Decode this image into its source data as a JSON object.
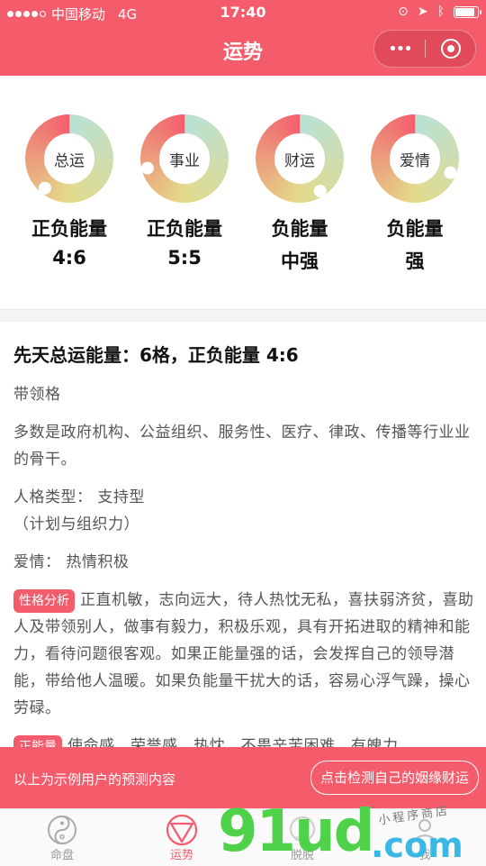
{
  "status_bar": {
    "carrier": "中国移动",
    "network": "4G",
    "time": "17:40"
  },
  "nav": {
    "title": "运势",
    "more_glyph": "•••"
  },
  "colors": {
    "brand": "#f45c6c",
    "gauge_red": "#f45c6c",
    "gauge_yellow": "#e3d98a",
    "gauge_teal": "#b8e2d4"
  },
  "gauges": [
    {
      "label": "总运",
      "line1": "正负能量",
      "line2": "4:6",
      "positive_fraction": 0.4
    },
    {
      "label": "事业",
      "line1": "正负能量",
      "line2": "5:5",
      "positive_fraction": 0.5
    },
    {
      "label": "财运",
      "line1": "负能量",
      "line2": "中强",
      "positive_fraction": 0.2
    },
    {
      "label": "爱情",
      "line1": "负能量",
      "line2": "强",
      "positive_fraction": 0.1
    }
  ],
  "content": {
    "heading": "先天总运能量：6格，正负能量 4:6",
    "p1": "带领格",
    "p2": "多数是政府机构、公益组织、服务性、医疗、律政、传播等行业业的骨干。",
    "p3a": "人格类型：  支持型",
    "p3b": "（计划与组织力）",
    "p4": "爱情：  热情积极",
    "tag1": "性格分析",
    "p5": "正直机敏，志向远大，待人热忱无私，喜扶弱济贫，喜助人及带领别人，做事有毅力，积极乐观，具有开拓进取的精神和能力，看待问题很客观。如果正能量强的话，会发挥自己的领导潜能，带给他人温暖。如果负能量干扰大的话，容易心浮气躁，操心劳碌。",
    "tag2": "正能量",
    "p6": "使命感、荣誉感、热忱，不畏辛苦困难，有魄力"
  },
  "banner": {
    "text": "以上为示例用户的预测内容",
    "button": "点击检测自己的姻缘财运"
  },
  "tabs": [
    {
      "label": "命盘"
    },
    {
      "label": "运势"
    },
    {
      "label": "脱脱"
    },
    {
      "label": "我"
    }
  ],
  "watermark": {
    "main": "91ud",
    "suffix": ".com",
    "hand": "小程序商店"
  }
}
